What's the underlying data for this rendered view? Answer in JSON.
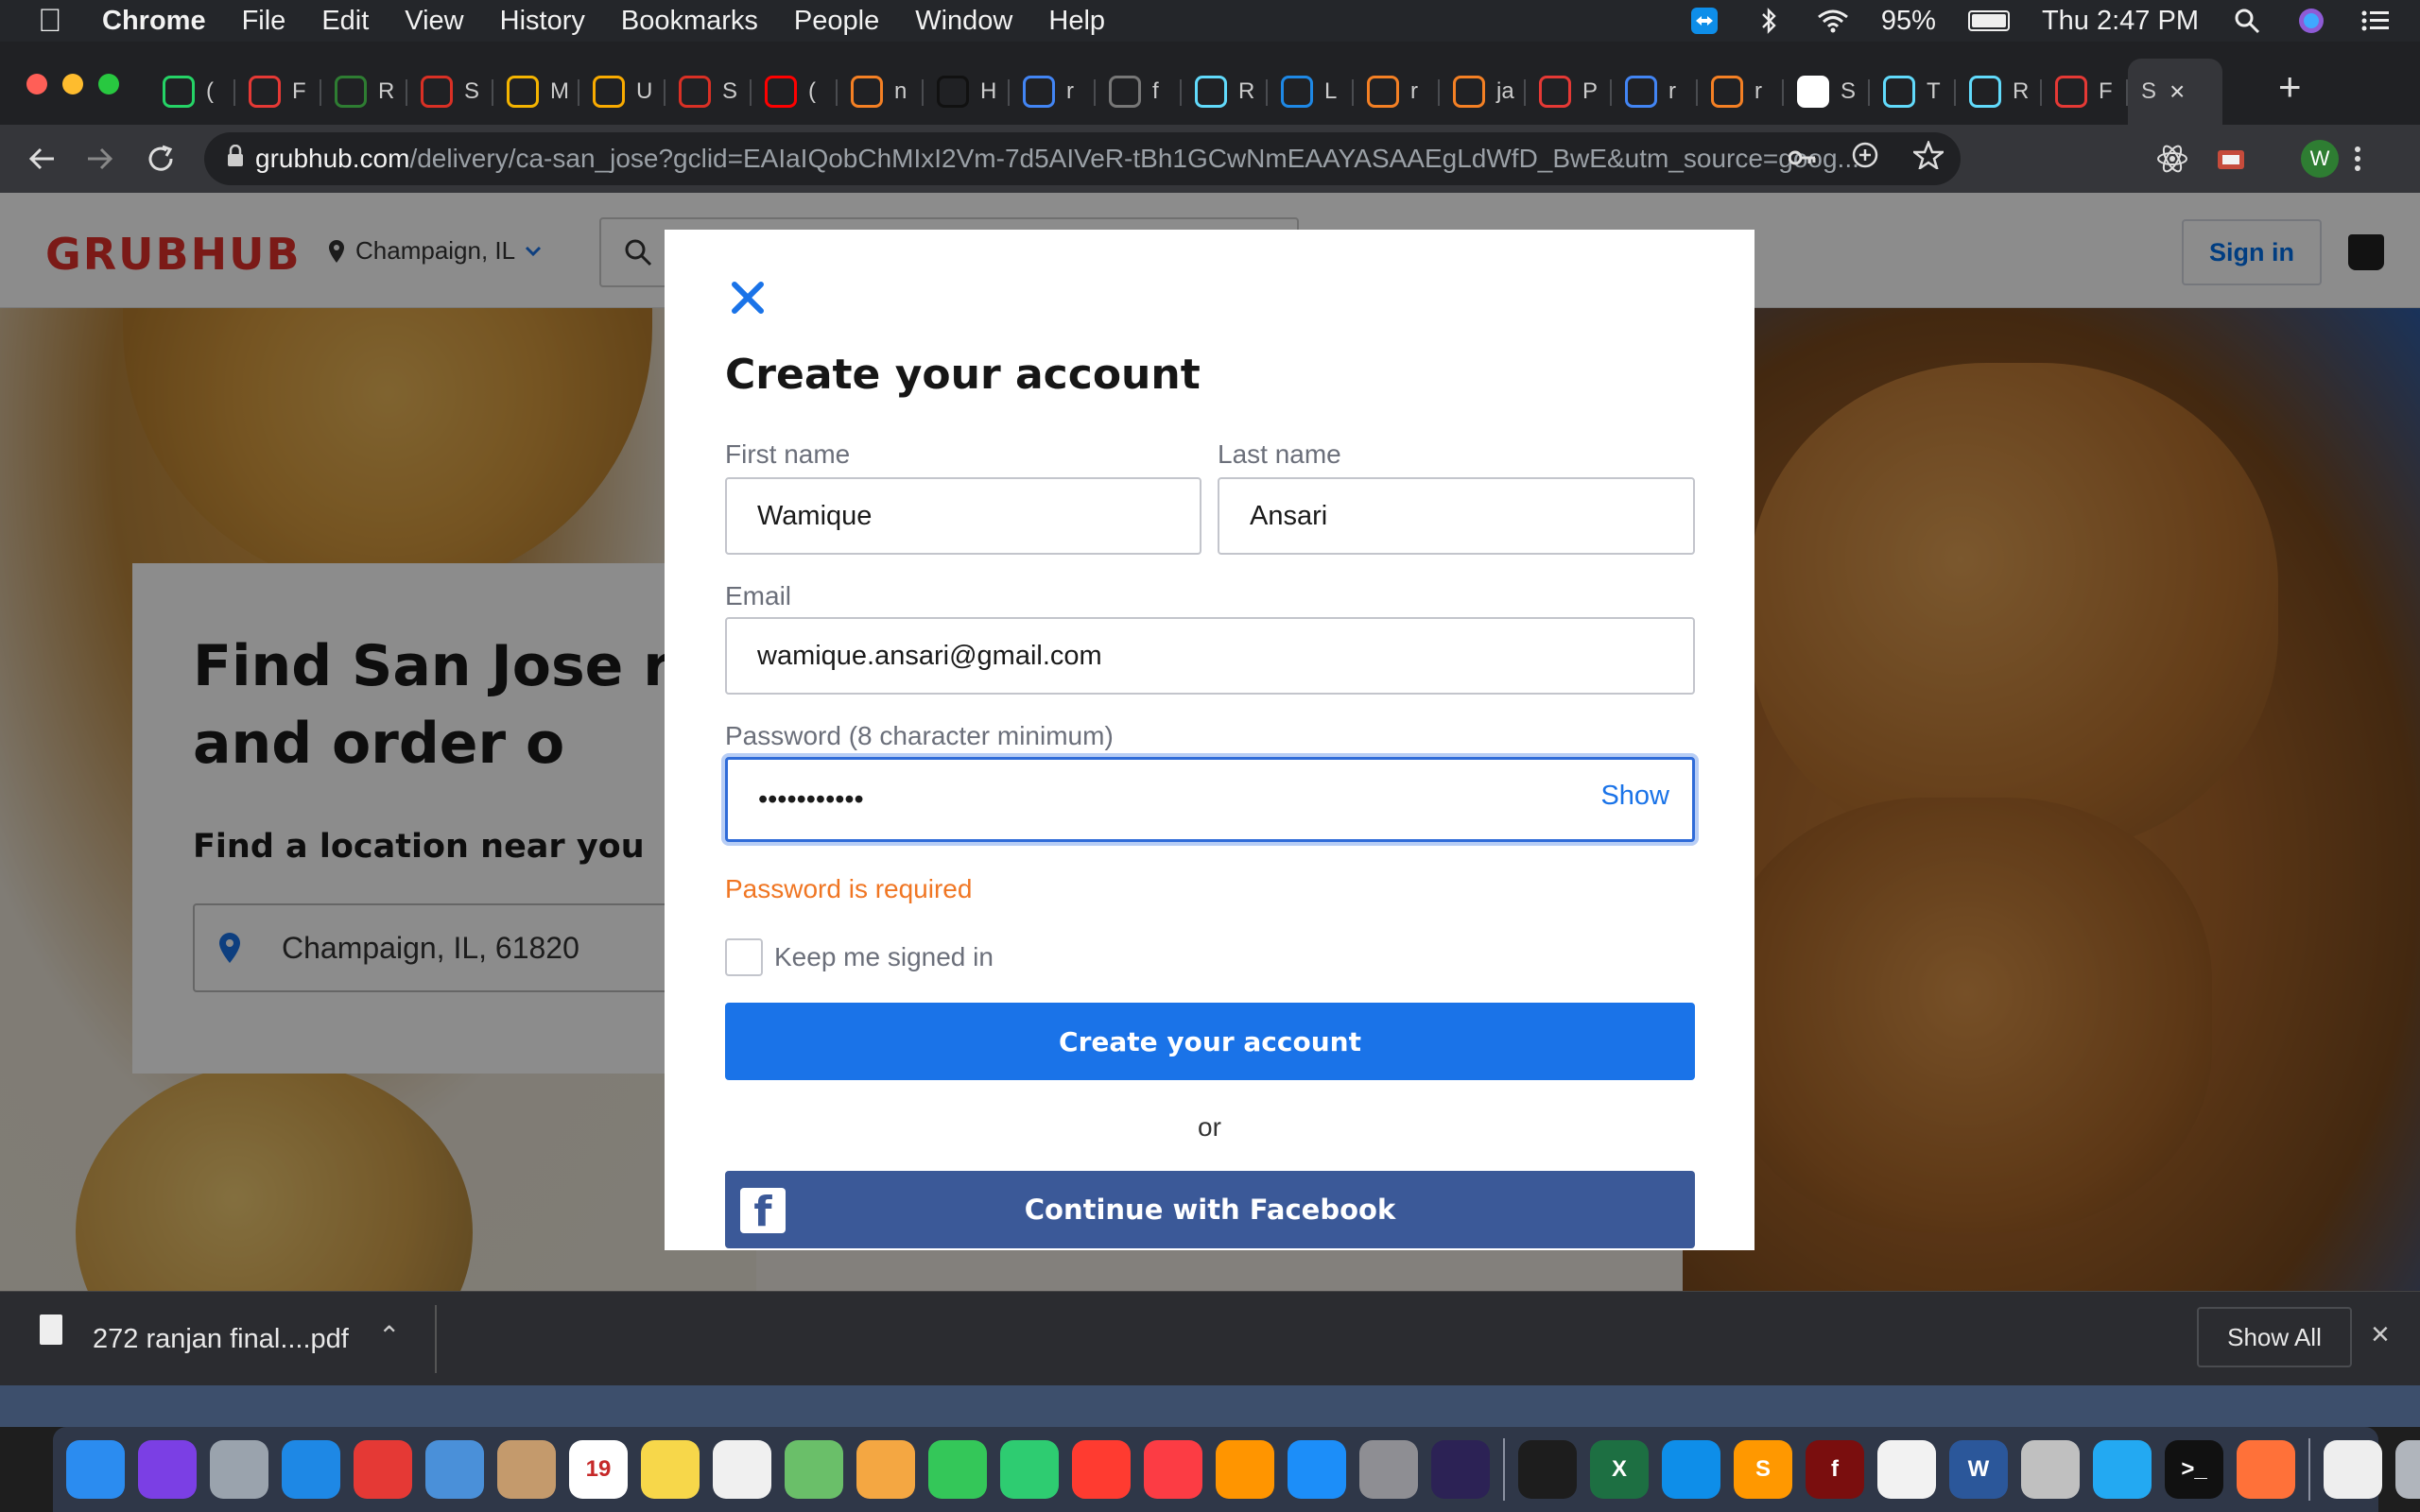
{
  "menubar": {
    "app": "Chrome",
    "items": [
      "File",
      "Edit",
      "View",
      "History",
      "Bookmarks",
      "People",
      "Window",
      "Help"
    ],
    "battery": "95%",
    "clock": "Thu 2:47 PM"
  },
  "tabs": [
    {
      "letter": "(",
      "color": "#25d366",
      "icon": "whatsapp-icon"
    },
    {
      "letter": "F",
      "color": "#e53935",
      "icon": "gear-icon"
    },
    {
      "letter": "R",
      "color": "#2e7d32",
      "icon": "hackerrank-icon"
    },
    {
      "letter": "S",
      "color": "#d93025",
      "icon": "gmail-icon"
    },
    {
      "letter": "M",
      "color": "#f4b400",
      "icon": "drive-icon"
    },
    {
      "letter": "U",
      "color": "#f9ab00",
      "icon": "slides-icon"
    },
    {
      "letter": "S",
      "color": "#d93025",
      "icon": "gmail-icon"
    },
    {
      "letter": "(",
      "color": "#ff0000",
      "icon": "youtube-icon"
    },
    {
      "letter": "n",
      "color": "#f48024",
      "icon": "stackoverflow-icon"
    },
    {
      "letter": "H",
      "color": "#111111",
      "icon": "github-icon"
    },
    {
      "letter": "r",
      "color": "#4285f4",
      "icon": "google-icon"
    },
    {
      "letter": "f",
      "color": "#777777",
      "icon": "globe-icon"
    },
    {
      "letter": "R",
      "color": "#61dafb",
      "icon": "react-icon"
    },
    {
      "letter": "L",
      "color": "#1e88e5",
      "icon": "dots-icon"
    },
    {
      "letter": "r",
      "color": "#f48024",
      "icon": "stackoverflow-icon"
    },
    {
      "letter": "ja",
      "color": "#f48024",
      "icon": "stackoverflow-icon"
    },
    {
      "letter": "P",
      "color": "#e53935",
      "icon": "pinterest-icon"
    },
    {
      "letter": "r",
      "color": "#4285f4",
      "icon": "google-icon"
    },
    {
      "letter": "r",
      "color": "#f48024",
      "icon": "stackoverflow-icon"
    },
    {
      "letter": "S",
      "color": "#ffffff",
      "icon": "medium-icon"
    },
    {
      "letter": "T",
      "color": "#61dafb",
      "icon": "react-icon"
    },
    {
      "letter": "R",
      "color": "#61dafb",
      "icon": "react-icon"
    },
    {
      "letter": "F",
      "color": "#e53935",
      "icon": "grubhub-icon"
    }
  ],
  "active_tab": {
    "label": "S",
    "close": "×"
  },
  "new_tab": "+",
  "omnibox": {
    "host": "grubhub.com",
    "path": "/delivery/ca-san_jose?gclid=EAIaIQobChMIxI2Vm-7d5AIVeR-tBh1GCwNmEAAYASAAEgLdWfD_BwE&utm_source=goog..."
  },
  "profile_initial": "W",
  "site": {
    "logo": "GRUBHUB",
    "location": "Champaign, IL",
    "signin": "Sign in",
    "headline": "Find San Jose re you and order o",
    "find_location": "Find a location near you",
    "location_input": "Champaign, IL, 61820"
  },
  "modal": {
    "close": "×",
    "title": "Create your account",
    "first_name_label": "First name",
    "first_name": "Wamique",
    "last_name_label": "Last name",
    "last_name": "Ansari",
    "email_label": "Email",
    "email": "wamique.ansari@gmail.com",
    "password_label": "Password (8 character minimum)",
    "password_mask": "•••••••••••",
    "show": "Show",
    "error": "Password is required",
    "keep_signed_in": "Keep me signed in",
    "create_button": "Create your account",
    "or": "or",
    "facebook_button": "Continue with Facebook"
  },
  "downloads": {
    "filename": "272 ranjan final....pdf",
    "show_all": "Show All"
  },
  "dock": [
    {
      "icon": "finder-icon",
      "color": "#2b8cf0"
    },
    {
      "icon": "siri-icon",
      "color": "#7b3fe4"
    },
    {
      "icon": "launchpad-icon",
      "color": "#9aa3ad"
    },
    {
      "icon": "safari-icon",
      "color": "#1e88e5"
    },
    {
      "icon": "chrome-icon",
      "color": "#e53935"
    },
    {
      "icon": "preview-icon",
      "color": "#4a90d9"
    },
    {
      "icon": "contacts-icon",
      "color": "#c49a6c"
    },
    {
      "icon": "calendar-icon",
      "color": "#ffffff",
      "label": "19"
    },
    {
      "icon": "notes-icon",
      "color": "#f7d74a"
    },
    {
      "icon": "reminders-icon",
      "color": "#f0f0f0"
    },
    {
      "icon": "maps-icon",
      "color": "#6abf69"
    },
    {
      "icon": "photos-icon",
      "color": "#f4a742"
    },
    {
      "icon": "messages-icon",
      "color": "#34c759"
    },
    {
      "icon": "facetime-icon",
      "color": "#2ecc71"
    },
    {
      "icon": "news-icon",
      "color": "#ff3b30"
    },
    {
      "icon": "music-icon",
      "color": "#fc3c44"
    },
    {
      "icon": "books-icon",
      "color": "#ff9500"
    },
    {
      "icon": "appstore-icon",
      "color": "#1c8ef9"
    },
    {
      "icon": "system-preferences-icon",
      "color": "#8e8e93"
    },
    {
      "icon": "eclipse-icon",
      "color": "#2c2255"
    },
    {
      "icon": "activity-monitor-icon",
      "color": "#1d1d1d"
    },
    {
      "icon": "excel-icon",
      "color": "#1d6f42",
      "label": "X"
    },
    {
      "icon": "teamviewer-icon",
      "color": "#0e8ee9"
    },
    {
      "icon": "sublime-icon",
      "color": "#ff9800",
      "label": "S"
    },
    {
      "icon": "flash-icon",
      "color": "#7a0e0e",
      "label": "f"
    },
    {
      "icon": "textedit-icon",
      "color": "#f2f2f2"
    },
    {
      "icon": "word-icon",
      "color": "#2b579a",
      "label": "W"
    },
    {
      "icon": "image-capture-icon",
      "color": "#c0c0c0"
    },
    {
      "icon": "vscode-icon",
      "color": "#23a9f2"
    },
    {
      "icon": "terminal-icon",
      "color": "#111111",
      "label": ">_"
    },
    {
      "icon": "firefox-icon",
      "color": "#ff7139"
    },
    {
      "icon": "document-icon",
      "color": "#eeeeee"
    },
    {
      "icon": "trash-icon",
      "color": "#b0b5bc"
    }
  ]
}
